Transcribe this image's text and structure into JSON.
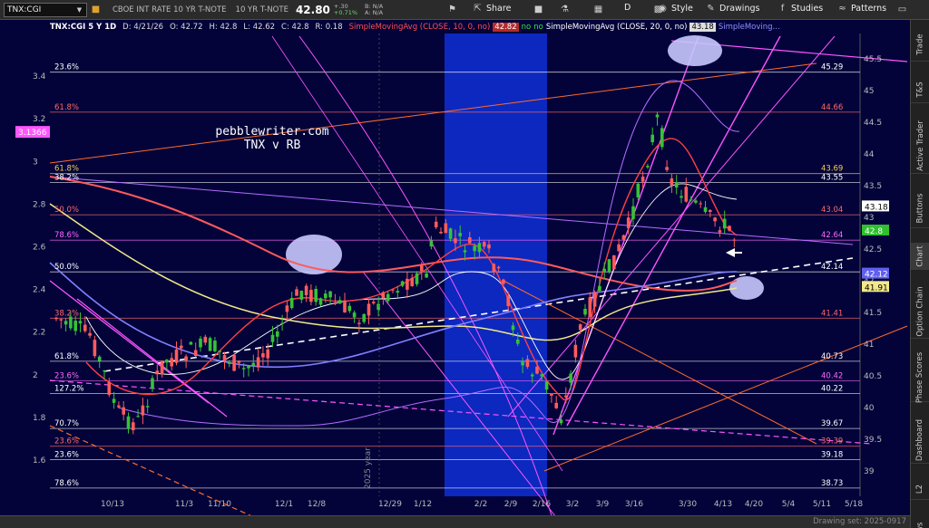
{
  "toolbar": {
    "symbol": "TNX:CGI",
    "description": "CBOE INT RATE 10 YR T-NOTE",
    "description2": "10 YR T-NOTE",
    "last": "42.80",
    "change": "+.30",
    "change_pct": "+0.71%",
    "bid": "B: N/A",
    "ask": "A: N/A",
    "share_label": "Share",
    "timeframe_label": "D",
    "style_label": "Style",
    "drawings_label": "Drawings",
    "studies_label": "Studies",
    "patterns_label": "Patterns"
  },
  "infobar": {
    "symbol_tf": "TNX:CGI 5 Y 1D",
    "date": "D: 4/21/26",
    "open": "O: 42.72",
    "high": "H: 42.8",
    "low": "L: 42.62",
    "close": "C: 42.8",
    "range": "R: 0.18",
    "sma10_label": "SimpleMovingAvg (CLOSE, 10, 0, no)",
    "sma10_value": "42.82",
    "no1": "no",
    "no2": "no",
    "sma20_label": "SimpleMovingAvg (CLOSE, 20, 0, no)",
    "sma20_value": "43.18",
    "sma_purple_label": "SimpleMoving..."
  },
  "watermark": {
    "line1": "pebblewriter.com",
    "line2": "TNX v RB"
  },
  "vertical_label": "2025 year",
  "colors": {
    "background": "#03033a",
    "highlight_band": "#0f2fd6",
    "sma10": "#ff5a5a",
    "sma20": "#ffffff",
    "sma50": "#8080ff",
    "sma200": "#f2e98a",
    "magenta": "#ff55ff",
    "orange": "#ff6a2a",
    "purple": "#b56cff"
  },
  "sidebar_tabs": [
    "Trade",
    "T&S",
    "Active Trader",
    "Buttons",
    "Chart",
    "Option Chain",
    "Phase Scores",
    "Dashboard",
    "L2",
    "News"
  ],
  "status": {
    "drawing_set": "Drawing set: 2025-0917"
  },
  "chart_data": {
    "type": "candlestick",
    "x_tick_labels": [
      "10/13",
      "11/3",
      "11/10",
      "12/1",
      "12/8",
      "12/29",
      "1/12",
      "2/2",
      "2/9",
      "2/16",
      "3/2",
      "3/9",
      "3/16",
      "3/30",
      "4/13",
      "4/20",
      "5/4",
      "5/11",
      "5/18"
    ],
    "y_right_ticks": [
      39,
      39.5,
      40,
      40.5,
      41,
      41.5,
      42,
      42.5,
      43,
      43.5,
      44,
      44.5,
      45,
      45.5
    ],
    "y_right_range": [
      38.6,
      45.9
    ],
    "y_left_ticks": [
      "1.6",
      "1.8",
      "2",
      "2.2",
      "2.4",
      "2.6",
      "2.8",
      "3",
      "3.2",
      "3.4"
    ],
    "y_left_range": [
      1.43,
      3.6
    ],
    "left_marker": "3.1366",
    "fib_lines": [
      {
        "left": "23.6%",
        "right": "45.29",
        "y": 45.29,
        "color": "#ffffff"
      },
      {
        "left": "61.8%",
        "right": "44.66",
        "y": 44.66,
        "color": "#ff6a6a"
      },
      {
        "left": "61.8%",
        "right": "43.69",
        "y": 43.69,
        "color": "#f2d24a"
      },
      {
        "left": "38.2%",
        "right": "43.55",
        "y": 43.55,
        "color": "#ffffff"
      },
      {
        "left": "50.0%",
        "right": "43.04",
        "y": 43.04,
        "color": "#ff6a6a"
      },
      {
        "left": "78.6%",
        "right": "42.64",
        "y": 42.64,
        "color": "#ff6aff"
      },
      {
        "left": "50.0%",
        "right": "42.14",
        "y": 42.14,
        "color": "#ffffff"
      },
      {
        "left": "38.2%",
        "right": "41.41",
        "y": 41.41,
        "color": "#ff6a6a"
      },
      {
        "left": "61.8%",
        "right": "40.73",
        "y": 40.73,
        "color": "#ffffff"
      },
      {
        "left": "23.6%",
        "right": "40.42",
        "y": 40.42,
        "color": "#ff6aff"
      },
      {
        "left": "127.2%",
        "right": "40.22",
        "y": 40.22,
        "color": "#ffffff"
      },
      {
        "left": "70.7%",
        "right": "39.67",
        "y": 39.67,
        "color": "#ffffff"
      },
      {
        "left": "23.6%",
        "right": "39.39",
        "y": 39.39,
        "color": "#ff6a6a"
      },
      {
        "left": "23.6%",
        "right": "39.18",
        "y": 39.18,
        "color": "#ffffff"
      },
      {
        "left": "78.6%",
        "right": "38.73",
        "y": 38.73,
        "color": "#ffffff"
      }
    ],
    "right_value_boxes": [
      {
        "label": "43.18",
        "y": 43.18,
        "bg": "#ffffff",
        "fg": "#000000"
      },
      {
        "label": "42.8",
        "y": 42.8,
        "bg": "#2fbf2f",
        "fg": "#ffffff"
      },
      {
        "label": "42.12",
        "y": 42.12,
        "bg": "#6060ee",
        "fg": "#ffffff"
      },
      {
        "label": "41.91",
        "y": 41.91,
        "bg": "#f2e98a",
        "fg": "#000000"
      }
    ]
  }
}
